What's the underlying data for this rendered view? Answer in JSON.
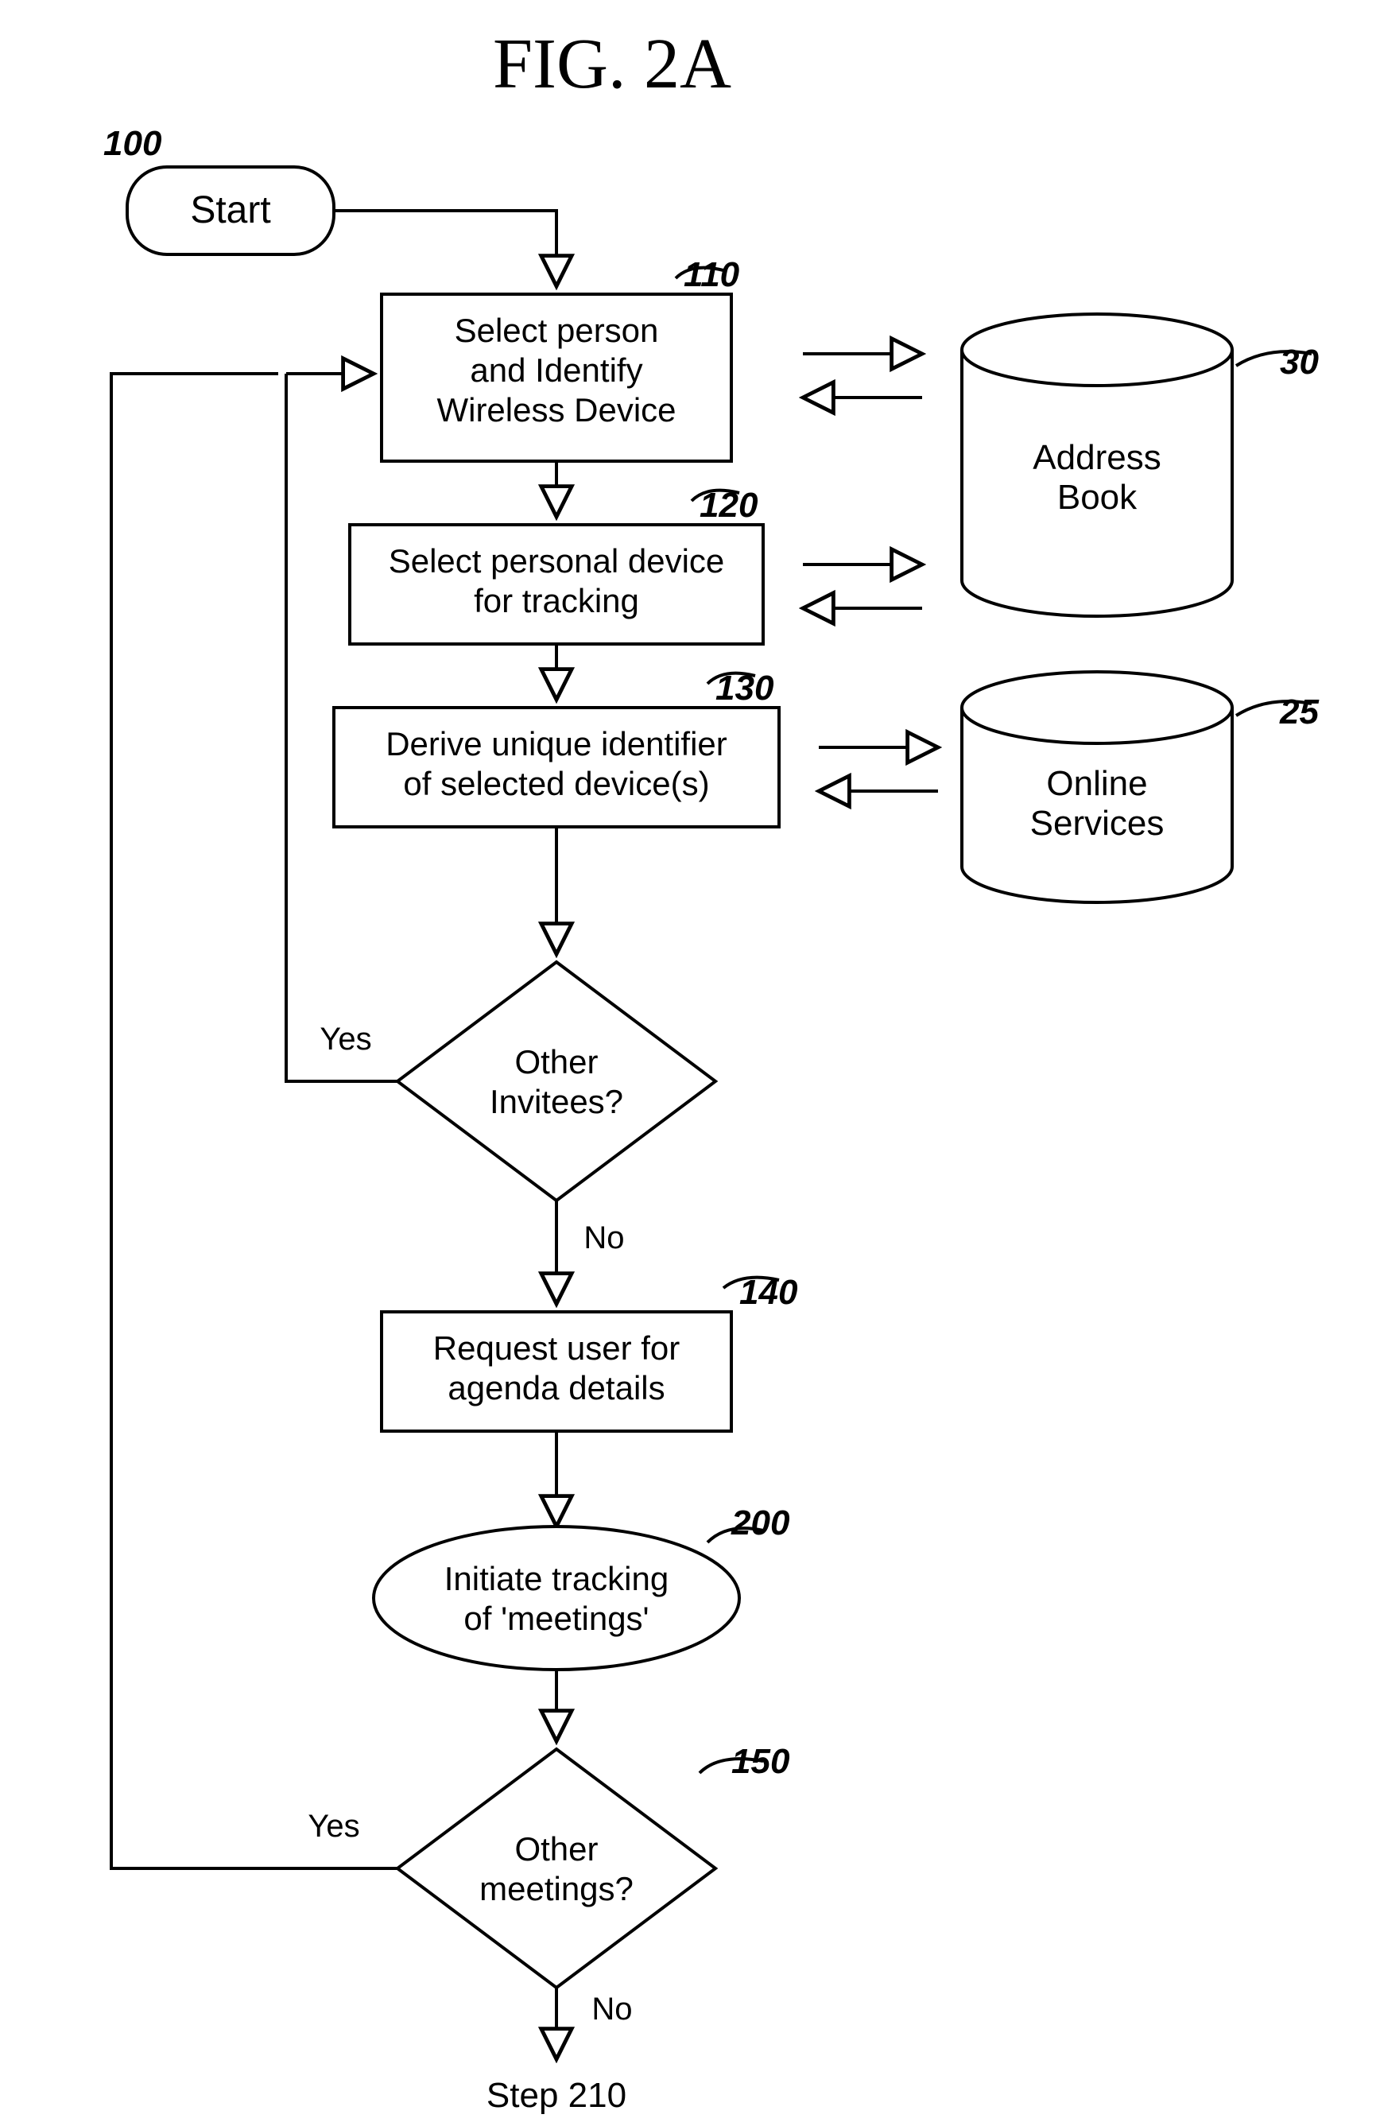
{
  "figure_title": "FIG. 2A",
  "refs": {
    "start": "100",
    "box110": "110",
    "box120": "120",
    "box130": "130",
    "box140": "140",
    "decision150": "150",
    "ellipse200": "200",
    "addrbook": "30",
    "services": "25"
  },
  "nodes": {
    "start": "Start",
    "box110_l1": "Select person",
    "box110_l2": "and Identify",
    "box110_l3": "Wireless Device",
    "box120_l1": "Select personal device",
    "box120_l2": "for tracking",
    "box130_l1": "Derive unique identifier",
    "box130_l2": "of selected device(s)",
    "dec_invitees_l1": "Other",
    "dec_invitees_l2": "Invitees?",
    "box140_l1": "Request user for",
    "box140_l2": "agenda details",
    "ellipse200_l1": "Initiate tracking",
    "ellipse200_l2": "of 'meetings'",
    "dec_meetings_l1": "Other",
    "dec_meetings_l2": "meetings?",
    "addrbook_l1": "Address",
    "addrbook_l2": "Book",
    "services_l1": "Online",
    "services_l2": "Services"
  },
  "labels": {
    "yes": "Yes",
    "no": "No",
    "step210": "Step 210"
  }
}
